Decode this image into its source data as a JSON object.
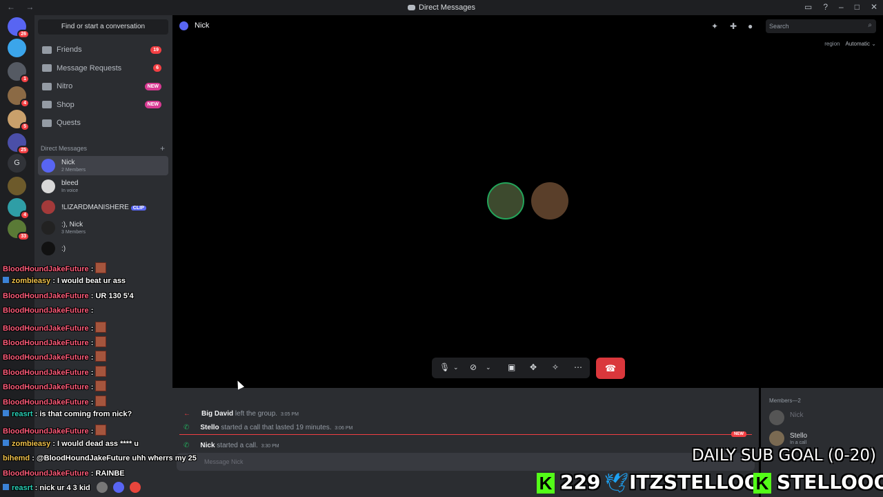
{
  "titlebar": {
    "title": "Direct Messages",
    "nav": "← →"
  },
  "rail": {
    "servers": [
      {
        "badge": "26",
        "color": "#5865f2"
      },
      {
        "badge": "",
        "color": "#3ba5ea"
      },
      {
        "badge": "1",
        "color": "#555a63"
      },
      {
        "badge": "4",
        "color": "#8b6a45"
      },
      {
        "badge": "5",
        "color": "#c9a06b"
      },
      {
        "badge": "25",
        "color": "#4b4fa8"
      },
      {
        "badge": "",
        "color": "#313338",
        "letter": "G"
      },
      {
        "badge": "",
        "color": "#6d5a2b"
      },
      {
        "badge": "4",
        "color": "#2f9ea6"
      },
      {
        "badge": "33",
        "color": "#5a7a36"
      }
    ]
  },
  "sidebar": {
    "find": "Find or start a conversation",
    "nav": [
      {
        "label": "Friends",
        "badge": "19",
        "new": false
      },
      {
        "label": "Message Requests",
        "badge": "6",
        "new": false
      },
      {
        "label": "Nitro",
        "badge": "NEW",
        "new": true
      },
      {
        "label": "Shop",
        "badge": "NEW",
        "new": true
      },
      {
        "label": "Quests",
        "badge": "",
        "new": false
      }
    ],
    "dm_header": "Direct Messages",
    "dms": [
      {
        "name": "Nick",
        "sub": "2 Members",
        "color": "#5865f2",
        "active": true
      },
      {
        "name": "bleed",
        "sub": "In voice",
        "color": "#d8d8d8",
        "active": false
      },
      {
        "name": "!LIZARDMANISHERE",
        "sub": "",
        "clip": "CLIP",
        "color": "#a33a3a",
        "active": false
      },
      {
        "name": ":), Nick",
        "sub": "3 Members",
        "color": "#222",
        "active": false
      },
      {
        "name": ":)",
        "sub": "",
        "color": "#111",
        "active": false
      }
    ]
  },
  "call": {
    "channel": "Nick",
    "search_placeholder": "Search",
    "region_label": "region",
    "region_value": "Automatic"
  },
  "chat": {
    "events": [
      {
        "user": "Big David",
        "text": "left the group.",
        "time": "3:05 PM",
        "kind": "leave"
      },
      {
        "user": "Stello",
        "text": "started a call that lasted 19 minutes.",
        "time": "3:06 PM",
        "kind": "call"
      },
      {
        "user": "Nick",
        "text": "started a call.",
        "time": "3:30 PM",
        "kind": "call"
      }
    ],
    "new_tag": "NEW",
    "placeholder": "Message Nick"
  },
  "members": {
    "header": "Members—2",
    "list": [
      {
        "name": "Nick",
        "sub": "",
        "color": "#555"
      },
      {
        "name": "Stello",
        "sub": "In a call",
        "color": "#7a6a52"
      }
    ]
  },
  "overlay": [
    {
      "user": "BloodHoundJakeFuture",
      "msg": ":",
      "emote": true,
      "color": "u",
      "icon": false
    },
    {
      "user": "zombieasy",
      "msg": ": I would beat ur ass",
      "emote": false,
      "color": "u y",
      "icon": true
    },
    {
      "user": "BloodHoundJakeFuture",
      "msg": ": UR 130 5'4",
      "emote": false,
      "color": "u",
      "icon": false
    },
    {
      "user": "BloodHoundJakeFuture",
      "msg": ":",
      "emote": false,
      "color": "u",
      "icon": false
    },
    {
      "user": "BloodHoundJakeFuture",
      "msg": ":",
      "emote": true,
      "color": "u",
      "icon": false
    },
    {
      "user": "BloodHoundJakeFuture",
      "msg": ":",
      "emote": true,
      "color": "u",
      "icon": false
    },
    {
      "user": "BloodHoundJakeFuture",
      "msg": ":",
      "emote": true,
      "color": "u",
      "icon": false
    },
    {
      "user": "BloodHoundJakeFuture",
      "msg": ":",
      "emote": true,
      "color": "u",
      "icon": false
    },
    {
      "user": "BloodHoundJakeFuture",
      "msg": ":",
      "emote": true,
      "color": "u",
      "icon": false
    },
    {
      "user": "BloodHoundJakeFuture",
      "msg": ":",
      "emote": true,
      "color": "u",
      "icon": false
    },
    {
      "user": "reasrt",
      "msg": ": is that coming from nick?",
      "emote": false,
      "color": "u g",
      "icon": true
    },
    {
      "user": "BloodHoundJakeFuture",
      "msg": ":",
      "emote": true,
      "color": "u",
      "icon": false
    },
    {
      "user": "zombieasy",
      "msg": ": I would dead ass **** u",
      "emote": false,
      "color": "u y",
      "icon": true
    },
    {
      "user": "bihemd",
      "msg": ": @BloodHoundJakeFuture uhh wherrs my 25",
      "emote": false,
      "color": "u y",
      "icon": false
    },
    {
      "user": "BloodHoundJakeFuture",
      "msg": ": RAINBE",
      "emote": false,
      "color": "u",
      "icon": false
    },
    {
      "user": "reasrt",
      "msg": ": nick ur 4 3 kid",
      "emote": false,
      "color": "u g",
      "icon": true
    }
  ],
  "stream": {
    "goal": "DAILY SUB GOAL (0-20)",
    "count": "229",
    "twitter": "ITZSTELLOO",
    "kick": "STELLOOO"
  }
}
